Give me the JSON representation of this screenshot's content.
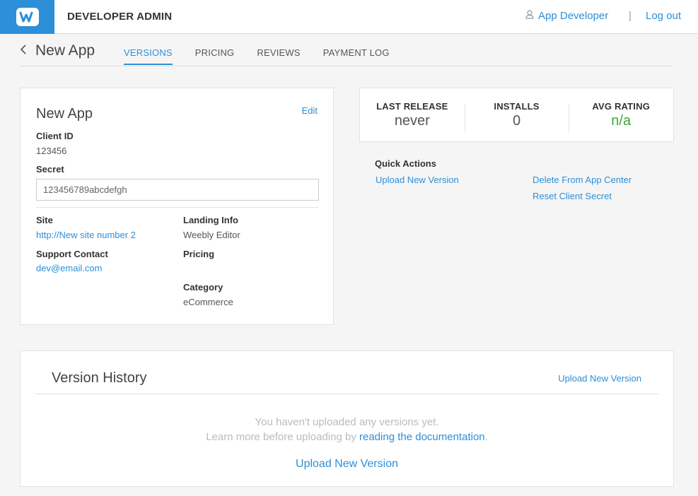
{
  "header": {
    "title": "DEVELOPER ADMIN",
    "user": "App Developer",
    "separator": "|",
    "logout": "Log out"
  },
  "subnav": {
    "back_title": "New App",
    "tabs": [
      {
        "label": "VERSIONS",
        "active": true
      },
      {
        "label": "PRICING",
        "active": false
      },
      {
        "label": "REVIEWS",
        "active": false
      },
      {
        "label": "PAYMENT LOG",
        "active": false
      }
    ]
  },
  "app_info": {
    "title": "New App",
    "edit_label": "Edit",
    "client_id_label": "Client ID",
    "client_id": "123456",
    "secret_label": "Secret",
    "secret": "123456789abcdefgh",
    "site_label": "Site",
    "site": "http://New site number 2",
    "support_label": "Support Contact",
    "support": "dev@email.com",
    "landing_label": "Landing Info",
    "landing": "Weebly Editor",
    "pricing_label": "Pricing",
    "category_label": "Category",
    "category": "eCommerce"
  },
  "stats": {
    "last_release_label": "LAST RELEASE",
    "last_release": "never",
    "installs_label": "INSTALLS",
    "installs": "0",
    "avg_rating_label": "AVG RATING",
    "avg_rating": "n/a"
  },
  "quick_actions": {
    "title": "Quick Actions",
    "upload": "Upload New Version",
    "delete": "Delete From App Center",
    "reset": "Reset Client Secret"
  },
  "version_history": {
    "title": "Version History",
    "upload_top": "Upload New Version",
    "empty_line1": "You haven't uploaded any versions yet.",
    "empty_line2_prefix": "Learn more before uploading by ",
    "empty_link": "reading the documentation",
    "empty_line2_suffix": ".",
    "upload_main": "Upload New Version"
  },
  "colors": {
    "brand": "#2c8fd8",
    "rating": "#3aaa35"
  }
}
